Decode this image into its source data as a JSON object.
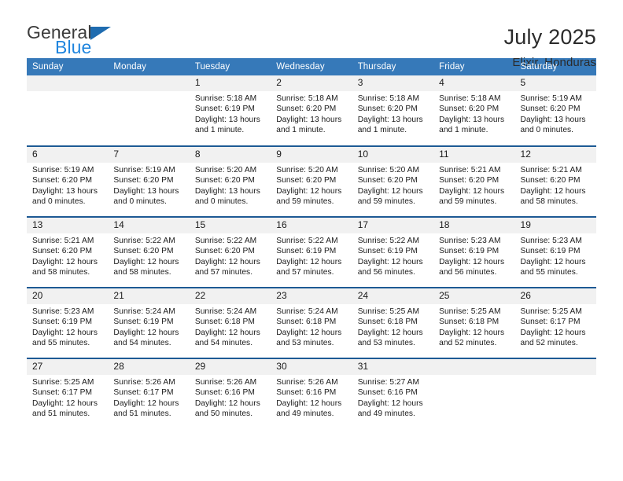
{
  "brand": {
    "line1": "General",
    "line2": "Blue",
    "logo_icon": "triangle-logo-icon",
    "accent_color": "#1f85de",
    "triangle_color": "#1f6cb0"
  },
  "header": {
    "title": "July 2025",
    "subtitle": "Elixir, Honduras"
  },
  "theme": {
    "header_row_bg": "#3679b9",
    "week_separator": "#1d5a94",
    "daynum_bg": "#f1f1f1"
  },
  "weekdays": [
    "Sunday",
    "Monday",
    "Tuesday",
    "Wednesday",
    "Thursday",
    "Friday",
    "Saturday"
  ],
  "weeks": [
    [
      {
        "day": "",
        "sunrise": "",
        "sunset": "",
        "daylight1": "",
        "daylight2": "",
        "empty": true
      },
      {
        "day": "",
        "sunrise": "",
        "sunset": "",
        "daylight1": "",
        "daylight2": "",
        "empty": true
      },
      {
        "day": "1",
        "sunrise": "Sunrise: 5:18 AM",
        "sunset": "Sunset: 6:19 PM",
        "daylight1": "Daylight: 13 hours",
        "daylight2": "and 1 minute."
      },
      {
        "day": "2",
        "sunrise": "Sunrise: 5:18 AM",
        "sunset": "Sunset: 6:20 PM",
        "daylight1": "Daylight: 13 hours",
        "daylight2": "and 1 minute."
      },
      {
        "day": "3",
        "sunrise": "Sunrise: 5:18 AM",
        "sunset": "Sunset: 6:20 PM",
        "daylight1": "Daylight: 13 hours",
        "daylight2": "and 1 minute."
      },
      {
        "day": "4",
        "sunrise": "Sunrise: 5:18 AM",
        "sunset": "Sunset: 6:20 PM",
        "daylight1": "Daylight: 13 hours",
        "daylight2": "and 1 minute."
      },
      {
        "day": "5",
        "sunrise": "Sunrise: 5:19 AM",
        "sunset": "Sunset: 6:20 PM",
        "daylight1": "Daylight: 13 hours",
        "daylight2": "and 0 minutes."
      }
    ],
    [
      {
        "day": "6",
        "sunrise": "Sunrise: 5:19 AM",
        "sunset": "Sunset: 6:20 PM",
        "daylight1": "Daylight: 13 hours",
        "daylight2": "and 0 minutes."
      },
      {
        "day": "7",
        "sunrise": "Sunrise: 5:19 AM",
        "sunset": "Sunset: 6:20 PM",
        "daylight1": "Daylight: 13 hours",
        "daylight2": "and 0 minutes."
      },
      {
        "day": "8",
        "sunrise": "Sunrise: 5:20 AM",
        "sunset": "Sunset: 6:20 PM",
        "daylight1": "Daylight: 13 hours",
        "daylight2": "and 0 minutes."
      },
      {
        "day": "9",
        "sunrise": "Sunrise: 5:20 AM",
        "sunset": "Sunset: 6:20 PM",
        "daylight1": "Daylight: 12 hours",
        "daylight2": "and 59 minutes."
      },
      {
        "day": "10",
        "sunrise": "Sunrise: 5:20 AM",
        "sunset": "Sunset: 6:20 PM",
        "daylight1": "Daylight: 12 hours",
        "daylight2": "and 59 minutes."
      },
      {
        "day": "11",
        "sunrise": "Sunrise: 5:21 AM",
        "sunset": "Sunset: 6:20 PM",
        "daylight1": "Daylight: 12 hours",
        "daylight2": "and 59 minutes."
      },
      {
        "day": "12",
        "sunrise": "Sunrise: 5:21 AM",
        "sunset": "Sunset: 6:20 PM",
        "daylight1": "Daylight: 12 hours",
        "daylight2": "and 58 minutes."
      }
    ],
    [
      {
        "day": "13",
        "sunrise": "Sunrise: 5:21 AM",
        "sunset": "Sunset: 6:20 PM",
        "daylight1": "Daylight: 12 hours",
        "daylight2": "and 58 minutes."
      },
      {
        "day": "14",
        "sunrise": "Sunrise: 5:22 AM",
        "sunset": "Sunset: 6:20 PM",
        "daylight1": "Daylight: 12 hours",
        "daylight2": "and 58 minutes."
      },
      {
        "day": "15",
        "sunrise": "Sunrise: 5:22 AM",
        "sunset": "Sunset: 6:20 PM",
        "daylight1": "Daylight: 12 hours",
        "daylight2": "and 57 minutes."
      },
      {
        "day": "16",
        "sunrise": "Sunrise: 5:22 AM",
        "sunset": "Sunset: 6:19 PM",
        "daylight1": "Daylight: 12 hours",
        "daylight2": "and 57 minutes."
      },
      {
        "day": "17",
        "sunrise": "Sunrise: 5:22 AM",
        "sunset": "Sunset: 6:19 PM",
        "daylight1": "Daylight: 12 hours",
        "daylight2": "and 56 minutes."
      },
      {
        "day": "18",
        "sunrise": "Sunrise: 5:23 AM",
        "sunset": "Sunset: 6:19 PM",
        "daylight1": "Daylight: 12 hours",
        "daylight2": "and 56 minutes."
      },
      {
        "day": "19",
        "sunrise": "Sunrise: 5:23 AM",
        "sunset": "Sunset: 6:19 PM",
        "daylight1": "Daylight: 12 hours",
        "daylight2": "and 55 minutes."
      }
    ],
    [
      {
        "day": "20",
        "sunrise": "Sunrise: 5:23 AM",
        "sunset": "Sunset: 6:19 PM",
        "daylight1": "Daylight: 12 hours",
        "daylight2": "and 55 minutes."
      },
      {
        "day": "21",
        "sunrise": "Sunrise: 5:24 AM",
        "sunset": "Sunset: 6:19 PM",
        "daylight1": "Daylight: 12 hours",
        "daylight2": "and 54 minutes."
      },
      {
        "day": "22",
        "sunrise": "Sunrise: 5:24 AM",
        "sunset": "Sunset: 6:18 PM",
        "daylight1": "Daylight: 12 hours",
        "daylight2": "and 54 minutes."
      },
      {
        "day": "23",
        "sunrise": "Sunrise: 5:24 AM",
        "sunset": "Sunset: 6:18 PM",
        "daylight1": "Daylight: 12 hours",
        "daylight2": "and 53 minutes."
      },
      {
        "day": "24",
        "sunrise": "Sunrise: 5:25 AM",
        "sunset": "Sunset: 6:18 PM",
        "daylight1": "Daylight: 12 hours",
        "daylight2": "and 53 minutes."
      },
      {
        "day": "25",
        "sunrise": "Sunrise: 5:25 AM",
        "sunset": "Sunset: 6:18 PM",
        "daylight1": "Daylight: 12 hours",
        "daylight2": "and 52 minutes."
      },
      {
        "day": "26",
        "sunrise": "Sunrise: 5:25 AM",
        "sunset": "Sunset: 6:17 PM",
        "daylight1": "Daylight: 12 hours",
        "daylight2": "and 52 minutes."
      }
    ],
    [
      {
        "day": "27",
        "sunrise": "Sunrise: 5:25 AM",
        "sunset": "Sunset: 6:17 PM",
        "daylight1": "Daylight: 12 hours",
        "daylight2": "and 51 minutes."
      },
      {
        "day": "28",
        "sunrise": "Sunrise: 5:26 AM",
        "sunset": "Sunset: 6:17 PM",
        "daylight1": "Daylight: 12 hours",
        "daylight2": "and 51 minutes."
      },
      {
        "day": "29",
        "sunrise": "Sunrise: 5:26 AM",
        "sunset": "Sunset: 6:16 PM",
        "daylight1": "Daylight: 12 hours",
        "daylight2": "and 50 minutes."
      },
      {
        "day": "30",
        "sunrise": "Sunrise: 5:26 AM",
        "sunset": "Sunset: 6:16 PM",
        "daylight1": "Daylight: 12 hours",
        "daylight2": "and 49 minutes."
      },
      {
        "day": "31",
        "sunrise": "Sunrise: 5:27 AM",
        "sunset": "Sunset: 6:16 PM",
        "daylight1": "Daylight: 12 hours",
        "daylight2": "and 49 minutes."
      },
      {
        "day": "",
        "sunrise": "",
        "sunset": "",
        "daylight1": "",
        "daylight2": "",
        "empty": true
      },
      {
        "day": "",
        "sunrise": "",
        "sunset": "",
        "daylight1": "",
        "daylight2": "",
        "empty": true
      }
    ]
  ]
}
